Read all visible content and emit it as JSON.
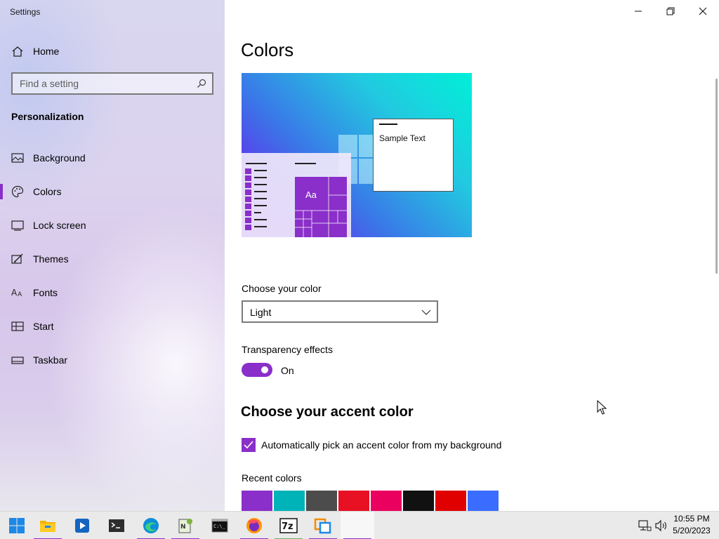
{
  "window": {
    "title": "Settings",
    "controls": [
      "minimize",
      "restore",
      "close"
    ]
  },
  "sidebar": {
    "home_label": "Home",
    "search_placeholder": "Find a setting",
    "section_title": "Personalization",
    "selected": "Colors",
    "items": [
      {
        "label": "Background",
        "icon": "picture-icon"
      },
      {
        "label": "Colors",
        "icon": "palette-icon"
      },
      {
        "label": "Lock screen",
        "icon": "lock-screen-icon"
      },
      {
        "label": "Themes",
        "icon": "brush-icon"
      },
      {
        "label": "Fonts",
        "icon": "font-icon"
      },
      {
        "label": "Start",
        "icon": "start-icon"
      },
      {
        "label": "Taskbar",
        "icon": "taskbar-icon"
      }
    ]
  },
  "main": {
    "title": "Colors",
    "preview": {
      "sample_text": "Sample Text",
      "tile_text": "Aa"
    },
    "choose_color": {
      "label": "Choose your color",
      "value": "Light"
    },
    "transparency": {
      "label": "Transparency effects",
      "state": "On",
      "enabled": true
    },
    "accent": {
      "heading": "Choose your accent color",
      "auto_pick_label": "Automatically pick an accent color from my background",
      "auto_pick_checked": true,
      "recent_label": "Recent colors",
      "recent_colors": [
        "#8a2fc9",
        "#00b3b8",
        "#4c4c4c",
        "#e81123",
        "#ea005e",
        "#111111",
        "#e00000",
        "#3a6cff"
      ]
    }
  },
  "colors": {
    "accent": "#8a2fc9"
  },
  "taskbar": {
    "apps": [
      "start-button",
      "file-explorer",
      "media-player",
      "terminal",
      "edge",
      "notepad-plus-plus",
      "command-prompt",
      "firefox",
      "7zip",
      "virtual-machine",
      "settings"
    ],
    "clock": {
      "time": "10:55 PM",
      "date": "5/20/2023"
    }
  }
}
